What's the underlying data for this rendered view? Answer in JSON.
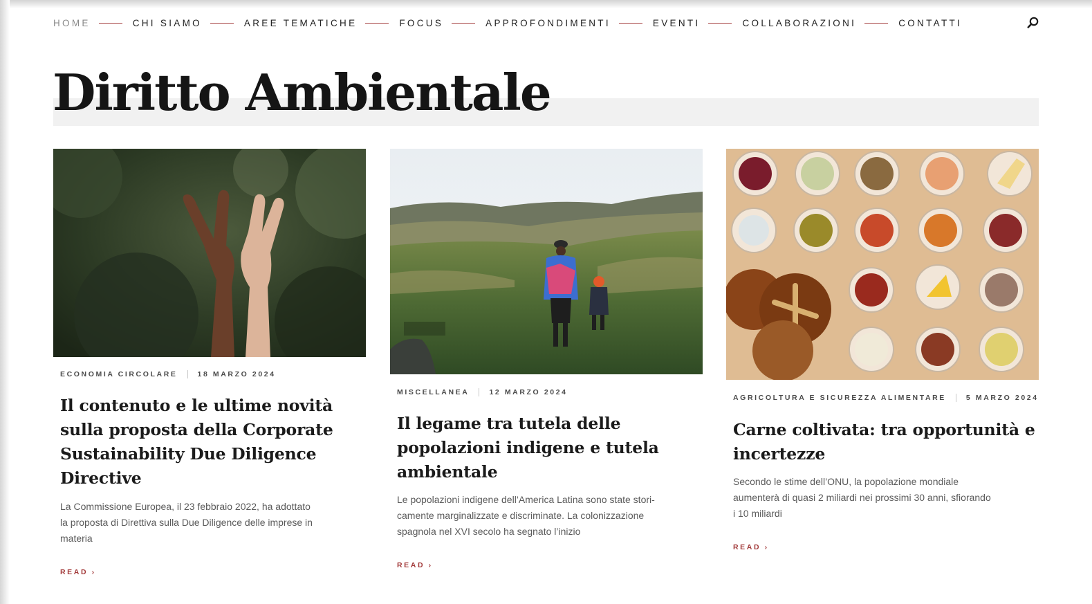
{
  "nav": {
    "items": [
      {
        "label": "HOME"
      },
      {
        "label": "CHI SIAMO"
      },
      {
        "label": "AREE TEMATICHE"
      },
      {
        "label": "FOCUS"
      },
      {
        "label": "APPROFONDIMENTI"
      },
      {
        "label": "EVENTI"
      },
      {
        "label": "COLLABORAZIONI"
      },
      {
        "label": "CONTATTI"
      }
    ],
    "search_icon": "search-icon"
  },
  "page": {
    "title": "Diritto Ambientale"
  },
  "colors": {
    "accent": "#a33b3b",
    "title_band": "#f1f1f1",
    "text": "#1b1b1b",
    "muted": "#5a5a5a"
  },
  "cards": [
    {
      "image": "hands-peace-sign-photo",
      "category": "ECONOMIA CIRCOLARE",
      "date": "18 MARZO 2024",
      "title_lines": [
        "Il contenuto e le ultime novità",
        "sulla proposta della Corporate",
        "Sustainability Due Diligence",
        "Directive"
      ],
      "excerpt_lines": [
        "La Commissione Europea, il 23 febbraio 2022, ha adottato",
        "la proposta di Direttiva sulla Due Diligence delle imprese in",
        "materia"
      ],
      "read_label": "READ ›"
    },
    {
      "image": "andes-landscape-family-photo",
      "category": "MISCELLANEA",
      "date": "12 MARZO 2024",
      "title_lines": [
        "Il legame tra tutela delle",
        "popolazioni indigene e tutela",
        "ambientale"
      ],
      "excerpt_lines": [
        "Le popolazioni indigene dell’America Latina sono state stori-",
        "camente marginalizzate e discriminate. La colonizzazione",
        "spagnola nel XVI secolo ha segnato l’inizio"
      ],
      "read_label": "READ ›"
    },
    {
      "image": "food-bowls-table-photo",
      "category": "AGRICOLTURA E SICUREZZA ALIMENTARE",
      "date": "5 MARZO 2024",
      "title_lines": [
        "Carne coltivata: tra opportunità e",
        "incertezze"
      ],
      "excerpt_lines": [
        "Secondo le stime dell’ONU, la popolazione mondiale",
        "aumenterà di quasi 2 miliardi nei prossimi 30 anni, sfiorando",
        "i 10 miliardi"
      ],
      "read_label": "READ ›"
    }
  ]
}
